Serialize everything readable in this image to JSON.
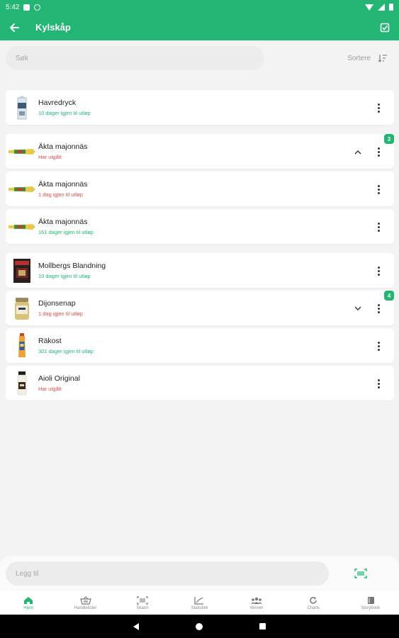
{
  "status_bar": {
    "time": "5:42"
  },
  "app_bar": {
    "title": "Kylskåp"
  },
  "search": {
    "placeholder": "Søk",
    "sort_label": "Sortere"
  },
  "items": [
    {
      "name": "Havredryck",
      "sub": "10 dager igjen til utløp",
      "status": "ok",
      "thumb": "carton"
    },
    {
      "name": "Äkta majonnäs",
      "sub": "Har utgått",
      "status": "bad",
      "thumb": "tube",
      "expand": "up",
      "badge": "3"
    },
    {
      "name": "Äkta majonnäs",
      "sub": "1 dag igjen til utløp",
      "status": "bad",
      "thumb": "tube"
    },
    {
      "name": "Äkta majonnäs",
      "sub": "161 dager igjen til utløp",
      "status": "ok",
      "thumb": "tube"
    },
    {
      "name": "Mollbergs Blandning",
      "sub": "10 dager igjen til utløp",
      "status": "ok",
      "thumb": "box"
    },
    {
      "name": "Dijonsenap",
      "sub": "1 dag igjen til utløp",
      "status": "bad",
      "thumb": "jar",
      "expand": "down",
      "badge": "4"
    },
    {
      "name": "Räkost",
      "sub": "301 dager igjen til utløp",
      "status": "ok",
      "thumb": "cheese-tube"
    },
    {
      "name": "Aioli Original",
      "sub": "Har utgått",
      "status": "bad",
      "thumb": "bottle"
    }
  ],
  "add": {
    "placeholder": "Legg til"
  },
  "nav": [
    {
      "label": "Hjem",
      "icon": "home-icon",
      "active": true
    },
    {
      "label": "Handlelister",
      "icon": "basket-icon",
      "active": false
    },
    {
      "label": "Skann",
      "icon": "barcode-icon",
      "active": false
    },
    {
      "label": "Statistikk",
      "icon": "chart-icon",
      "active": false
    },
    {
      "label": "Venner",
      "icon": "people-icon",
      "active": false
    },
    {
      "label": "Charts",
      "icon": "refresh-icon",
      "active": false
    },
    {
      "label": "Storybook",
      "icon": "book-icon",
      "active": false
    }
  ],
  "colors": {
    "primary": "#23b573",
    "expired": "#e94b4b"
  }
}
